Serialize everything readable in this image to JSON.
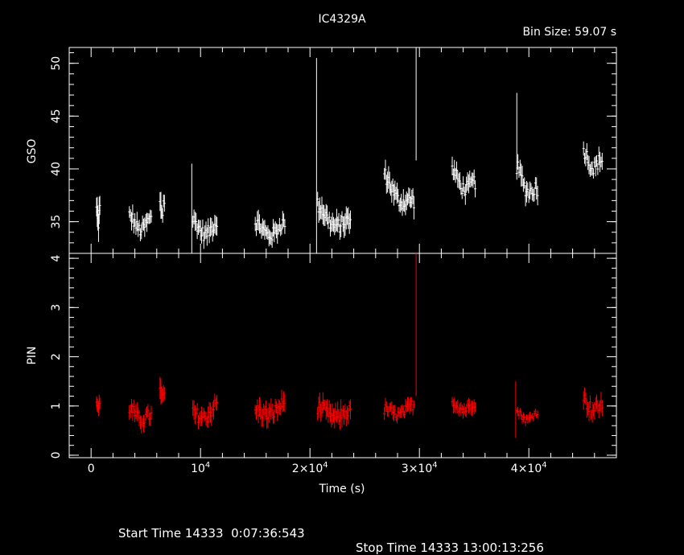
{
  "chart_data": {
    "title": "IC4329A",
    "bin_size": "Bin Size: 59.07 s",
    "xlabel": "Time (s)",
    "xlim": [
      -2000,
      48000
    ],
    "x_tick_labels": [
      {
        "value": 0,
        "text": "0"
      },
      {
        "value": 10000,
        "text": "10",
        "sup": "4"
      },
      {
        "value": 20000,
        "text": "2×10",
        "sup": "4"
      },
      {
        "value": 30000,
        "text": "3×10",
        "sup": "4"
      },
      {
        "value": 40000,
        "text": "4×10",
        "sup": "4"
      }
    ],
    "panels": [
      {
        "name": "GSO",
        "ylabel": "GSO",
        "type": "scatter",
        "color": "#ffffff",
        "ylim": [
          32,
          51.5
        ],
        "y_ticks": [
          35,
          40,
          45,
          50
        ],
        "segments": [
          {
            "x0": 500,
            "x1": 800,
            "mean": 35.5,
            "amp": 1.3,
            "slope": 0
          },
          {
            "x0": 3500,
            "x1": 5500,
            "mean": 34.8,
            "amp": 0.9,
            "slope": -0.3
          },
          {
            "x0": 6300,
            "x1": 6700,
            "mean": 36.5,
            "amp": 1.2,
            "slope": 0
          },
          {
            "x0": 9300,
            "x1": 11500,
            "mean": 34.4,
            "amp": 0.9,
            "slope": -0.2
          },
          {
            "x0": 15000,
            "x1": 17700,
            "mean": 34.3,
            "amp": 0.9,
            "slope": 0
          },
          {
            "x0": 20700,
            "x1": 23700,
            "mean": 35.2,
            "amp": 1.0,
            "slope": -1.5
          },
          {
            "x0": 26800,
            "x1": 29500,
            "mean": 37.6,
            "amp": 1.0,
            "slope": -2.5
          },
          {
            "x0": 33000,
            "x1": 35100,
            "mean": 38.7,
            "amp": 0.9,
            "slope": -1.2
          },
          {
            "x0": 38900,
            "x1": 40800,
            "mean": 38.5,
            "amp": 1.0,
            "slope": -2.0
          },
          {
            "x0": 45000,
            "x1": 46700,
            "mean": 40.7,
            "amp": 0.9,
            "slope": -0.8
          }
        ],
        "spikes": [
          {
            "x": 9200,
            "y0": 32,
            "y1": 40.5
          },
          {
            "x": 20600,
            "y0": 32,
            "y1": 50.5
          },
          {
            "x": 29700,
            "y0": 40.8,
            "y1": 51.5
          },
          {
            "x": 38900,
            "y0": 40,
            "y1": 47.2
          }
        ]
      },
      {
        "name": "PIN",
        "ylabel": "PIN",
        "type": "scatter",
        "color": "#ff0000",
        "ylim": [
          -0.05,
          4.1
        ],
        "y_ticks": [
          0,
          1,
          2,
          3,
          4
        ],
        "segments": [
          {
            "x0": 500,
            "x1": 800,
            "mean": 1.0,
            "amp": 0.15,
            "slope": 0
          },
          {
            "x0": 3500,
            "x1": 5500,
            "mean": 0.8,
            "amp": 0.18,
            "slope": -0.15
          },
          {
            "x0": 6300,
            "x1": 6700,
            "mean": 1.2,
            "amp": 0.25,
            "slope": 0
          },
          {
            "x0": 9300,
            "x1": 11500,
            "mean": 0.85,
            "amp": 0.2,
            "slope": 0.2
          },
          {
            "x0": 15000,
            "x1": 17700,
            "mean": 0.9,
            "amp": 0.2,
            "slope": 0.15
          },
          {
            "x0": 20700,
            "x1": 23700,
            "mean": 0.85,
            "amp": 0.2,
            "slope": -0.1
          },
          {
            "x0": 26800,
            "x1": 29500,
            "mean": 0.9,
            "amp": 0.15,
            "slope": 0.1
          },
          {
            "x0": 33000,
            "x1": 35100,
            "mean": 1.0,
            "amp": 0.15,
            "slope": 0
          },
          {
            "x0": 38900,
            "x1": 40800,
            "mean": 0.8,
            "amp": 0.1,
            "slope": 0
          },
          {
            "x0": 45000,
            "x1": 46700,
            "mean": 1.0,
            "amp": 0.2,
            "slope": -0.1
          }
        ],
        "spikes": [
          {
            "x": 29700,
            "y0": 1.2,
            "y1": 4.1
          },
          {
            "x": 38800,
            "y0": 0.35,
            "y1": 1.5
          }
        ]
      }
    ]
  },
  "footer": {
    "start": "Start Time 14333  0:07:36:543",
    "stop": "Stop Time 14333 13:00:13:256"
  }
}
